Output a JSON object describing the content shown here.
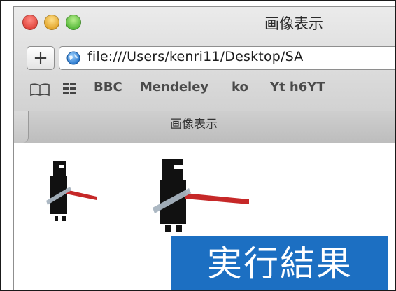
{
  "window": {
    "title": "画像表示"
  },
  "toolbar": {
    "new_tab_symbol": "+",
    "url": "file:///Users/kenri11/Desktop/SA"
  },
  "bookmarks": {
    "items": [
      "BBC",
      "Mendeley",
      "ko",
      "Yt h6YT"
    ]
  },
  "tabs": {
    "active_label": "画像表示"
  },
  "content": {
    "images": [
      "robot-sprite",
      "robot-sprite"
    ]
  },
  "overlay": {
    "caption": "実行結果",
    "background": "#1c6fc2"
  },
  "colors": {
    "close": "#e0443c",
    "minimize": "#e2a42a",
    "maximize": "#56b93a",
    "robot_body": "#111111",
    "robot_arm": "#c62828",
    "robot_stripe": "#a8b4c0"
  }
}
